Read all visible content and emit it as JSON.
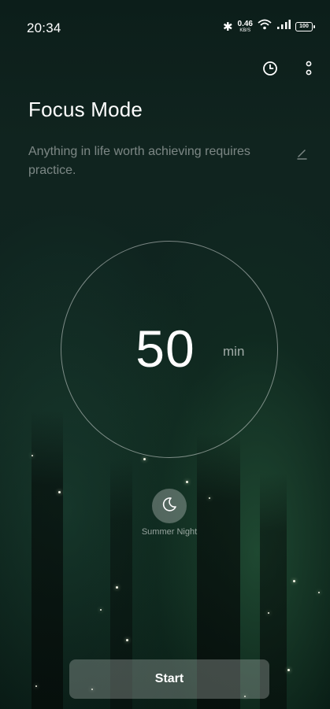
{
  "status_bar": {
    "time": "20:34",
    "network_speed_value": "0.46",
    "network_speed_unit": "KB/S",
    "battery": "100",
    "icons": [
      "bluetooth-icon",
      "wifi-icon",
      "signal-icon",
      "battery-icon"
    ]
  },
  "header": {
    "title": "Focus Mode",
    "quote": "Anything in life worth achieving requires practice.",
    "actions": [
      "history-clock-icon",
      "more-vertical-icon",
      "edit-pencil-icon"
    ]
  },
  "timer": {
    "value": "50",
    "unit": "min"
  },
  "sound": {
    "label": "Summer Night",
    "icon": "moon-icon"
  },
  "start_button": {
    "label": "Start"
  },
  "colors": {
    "background_dark": "#0c1e1a",
    "text_primary": "#ffffff",
    "text_muted": "rgba(255,255,255,0.45)",
    "button_fill": "rgba(190,195,192,0.32)"
  }
}
